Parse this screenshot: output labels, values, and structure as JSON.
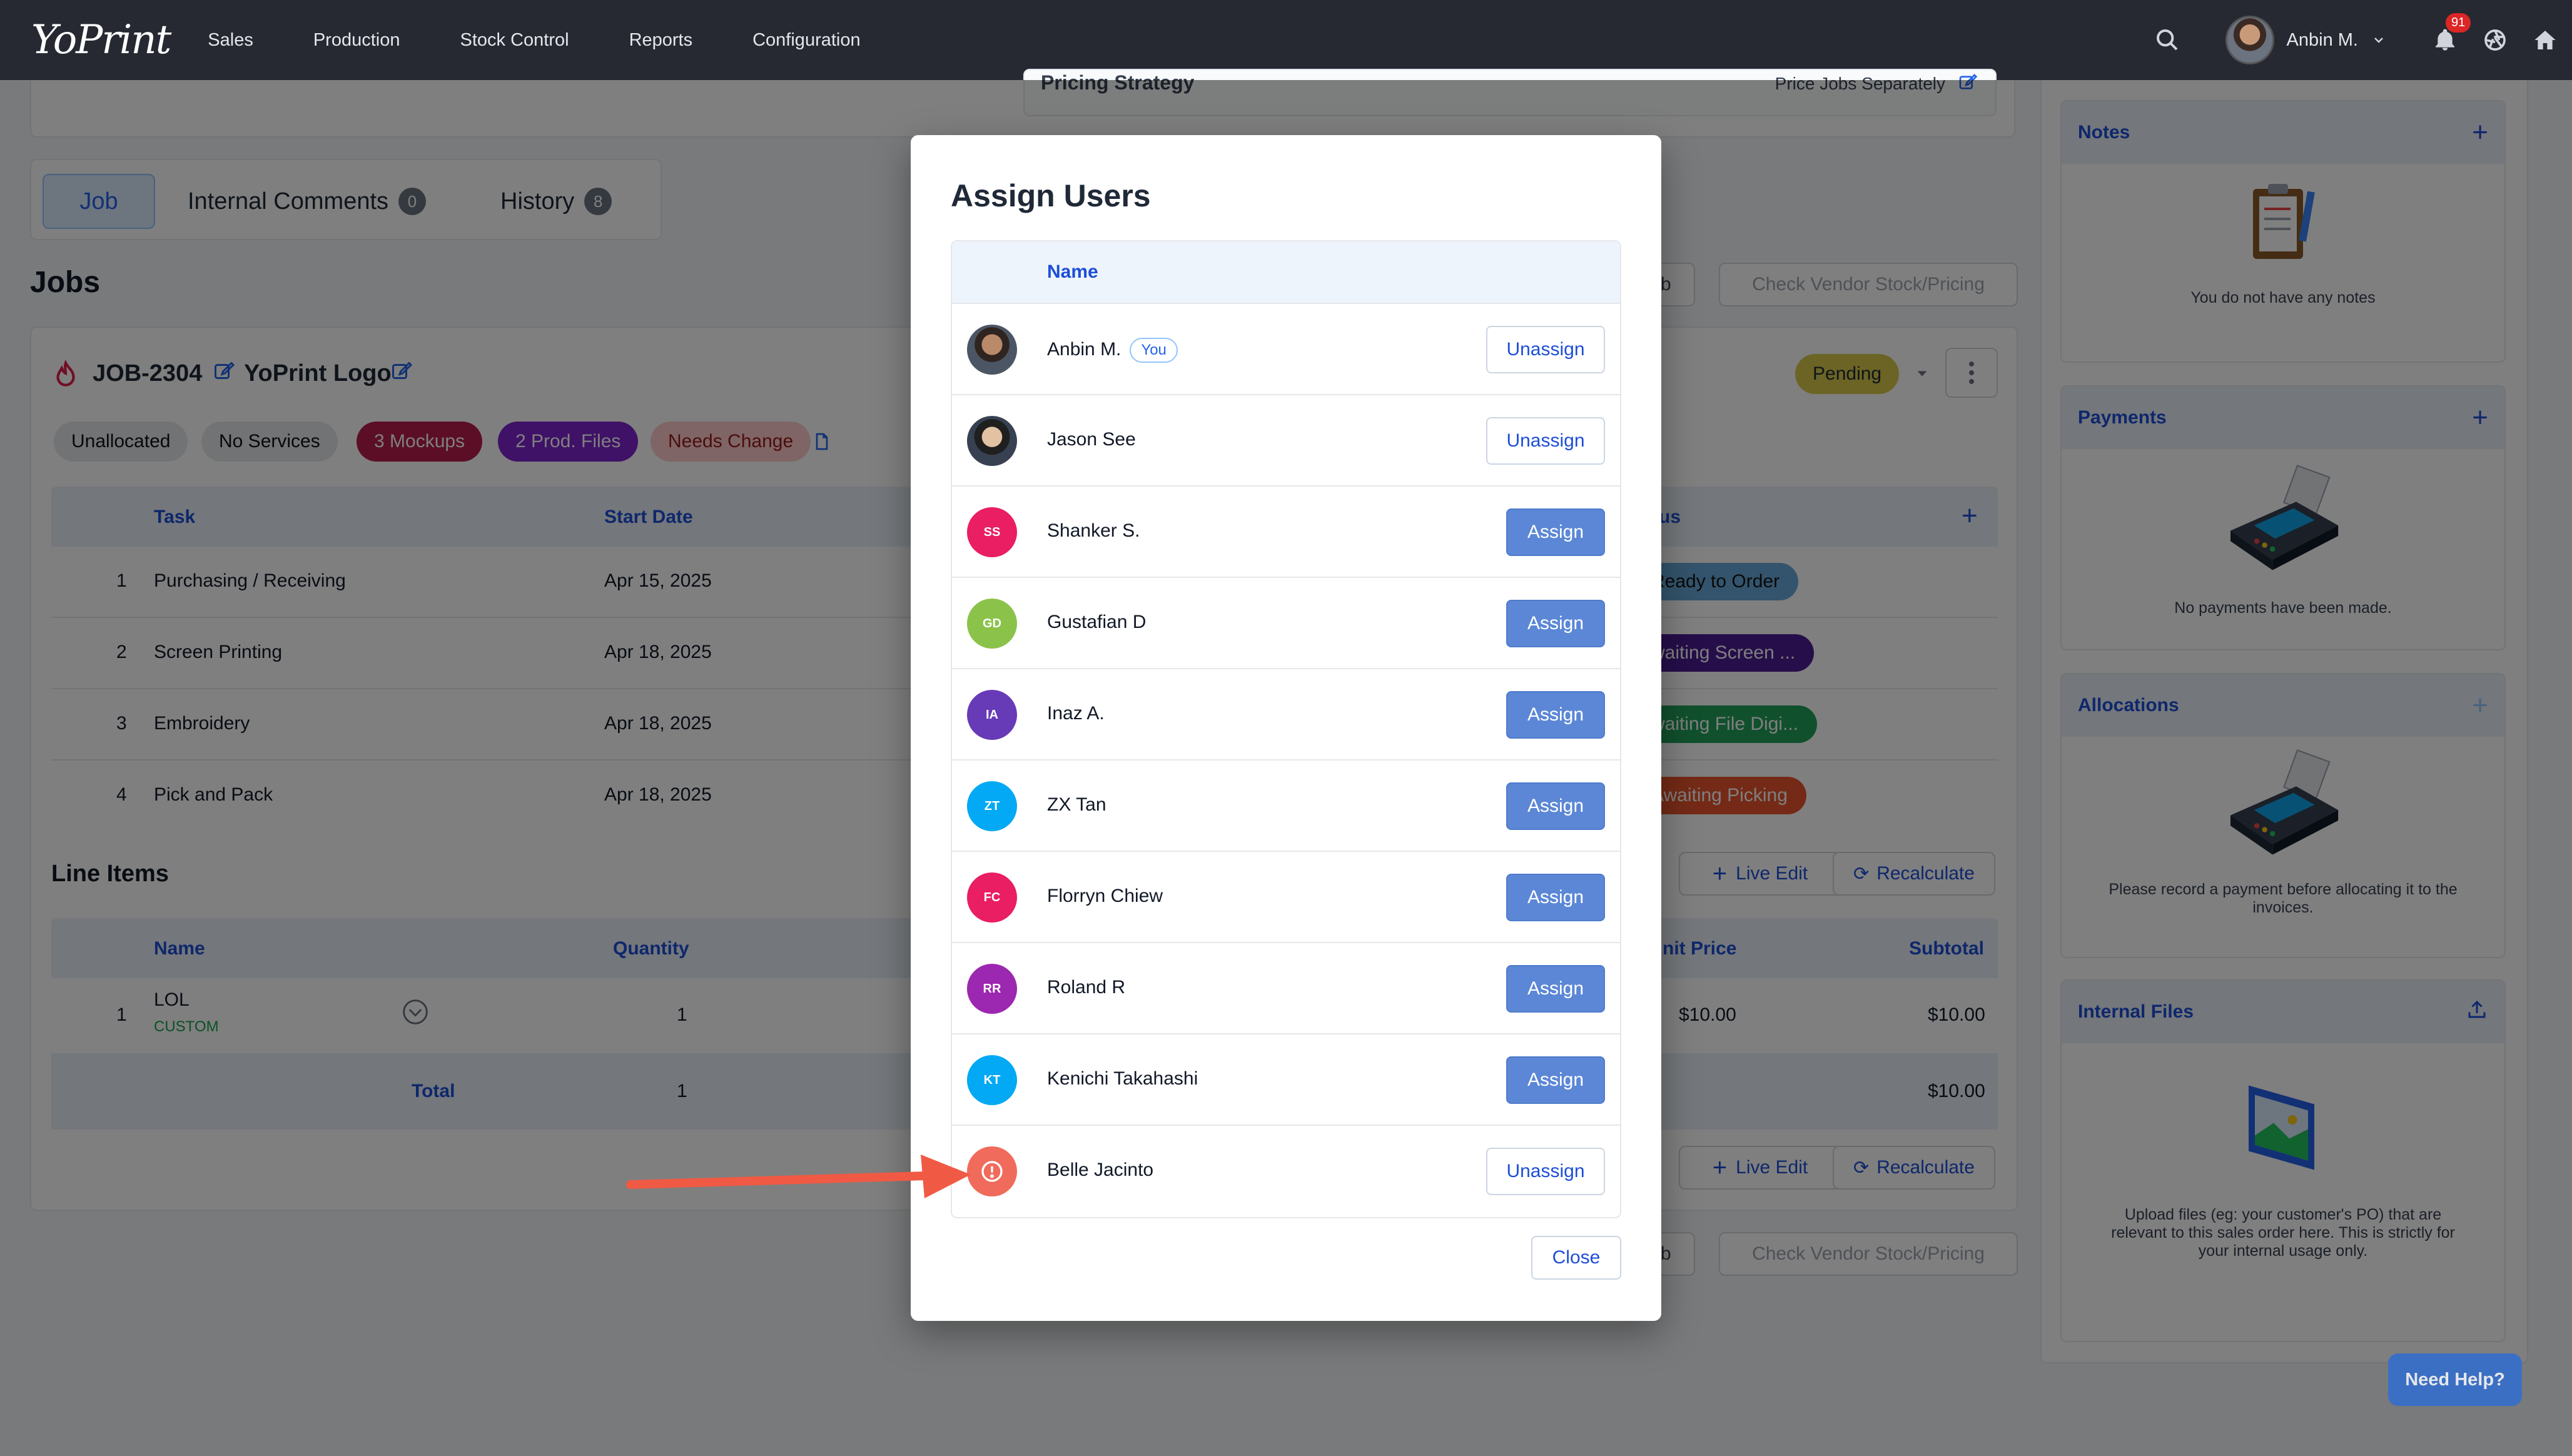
{
  "nav": {
    "logo": "YoPrint",
    "items": [
      "Sales",
      "Production",
      "Stock Control",
      "Reports",
      "Configuration"
    ],
    "user_name": "Anbin M.",
    "notification_count": "91"
  },
  "page": {
    "pricing_strategy_label": "Pricing Strategy",
    "pricing_strategy_value": "Price Jobs Separately",
    "tabs": [
      {
        "label": "Job",
        "count": ""
      },
      {
        "label": "Internal Comments",
        "count": "0"
      },
      {
        "label": "History",
        "count": "8"
      }
    ],
    "jobs_heading": "Jobs",
    "job_button_fragment": "ob",
    "check_vendor_button": "Check Vendor Stock/Pricing",
    "job": {
      "code": "JOB-2304",
      "name": "YoPrint Logo",
      "status": "Pending",
      "chips": [
        "Unallocated",
        "No Services",
        "3 Mockups",
        "2 Prod. Files",
        "Needs Change"
      ]
    },
    "task_table": {
      "headers": [
        "Task",
        "Start Date",
        "tus"
      ],
      "rows": [
        {
          "num": "1",
          "task": "Purchasing / Receiving",
          "date": "Apr 15, 2025",
          "status": "Ready to Order"
        },
        {
          "num": "2",
          "task": "Screen Printing",
          "date": "Apr 18, 2025",
          "status": "waiting Screen ..."
        },
        {
          "num": "3",
          "task": "Embroidery",
          "date": "Apr 18, 2025",
          "status": "waiting File Digi..."
        },
        {
          "num": "4",
          "task": "Pick and Pack",
          "date": "Apr 18, 2025",
          "status": "Awaiting Picking"
        }
      ]
    },
    "line_items": {
      "heading": "Line Items",
      "live_edit": "Live Edit",
      "recalculate": "Recalculate",
      "headers": [
        "Name",
        "Quantity",
        "nit Price",
        "Subtotal"
      ],
      "row": {
        "num": "1",
        "name": "LOL",
        "tag": "CUSTOM",
        "quantity": "1",
        "unit_price": "$10.00",
        "subtotal": "$10.00"
      },
      "total_label": "Total",
      "total_quantity": "1",
      "total_subtotal": "$10.00"
    },
    "sidebar": {
      "notes": {
        "title": "Notes",
        "message": "You do not have any notes"
      },
      "payments": {
        "title": "Payments",
        "message": "No payments have been made."
      },
      "allocations": {
        "title": "Allocations",
        "message": "Please record a payment before allocating it to the invoices."
      },
      "internal_files": {
        "title": "Internal Files",
        "message": "Upload files (eg: your customer's PO) that are relevant to this sales order here. This is strictly for your internal usage only."
      }
    },
    "help_button": "Need Help?"
  },
  "modal": {
    "title": "Assign Users",
    "column_name": "Name",
    "you_badge": "You",
    "close_label": "Close",
    "users": [
      {
        "name": "Anbin M.",
        "initials": "",
        "avatar": "photo1",
        "color": "",
        "action": "Unassign",
        "you": true
      },
      {
        "name": "Jason See",
        "initials": "",
        "avatar": "photo2",
        "color": "",
        "action": "Unassign",
        "you": false
      },
      {
        "name": "Shanker S.",
        "initials": "SS",
        "avatar": "initials",
        "color": "#e91e63",
        "action": "Assign",
        "you": false
      },
      {
        "name": "Gustafian D",
        "initials": "GD",
        "avatar": "initials",
        "color": "#8bc34a",
        "action": "Assign",
        "you": false
      },
      {
        "name": "Inaz A.",
        "initials": "IA",
        "avatar": "initials",
        "color": "#673ab7",
        "action": "Assign",
        "you": false
      },
      {
        "name": "ZX Tan",
        "initials": "ZT",
        "avatar": "initials",
        "color": "#03a9f4",
        "action": "Assign",
        "you": false
      },
      {
        "name": "Florryn Chiew",
        "initials": "FC",
        "avatar": "initials",
        "color": "#e91e63",
        "action": "Assign",
        "you": false
      },
      {
        "name": "Roland R",
        "initials": "RR",
        "avatar": "initials",
        "color": "#9c27b0",
        "action": "Assign",
        "you": false
      },
      {
        "name": "Kenichi Takahashi",
        "initials": "KT",
        "avatar": "initials",
        "color": "#03a9f4",
        "action": "Assign",
        "you": false
      },
      {
        "name": "Belle Jacinto",
        "initials": "",
        "avatar": "alert",
        "color": "#f06b5b",
        "action": "Unassign",
        "you": false
      }
    ]
  },
  "colors": {
    "annotation_arrow": "#f05a44",
    "mockups_chip": "#b91c4c",
    "prod_files_chip": "#7e22ce",
    "needs_change_chip": "#fecaca",
    "pending_pill": "#d6c94a"
  }
}
